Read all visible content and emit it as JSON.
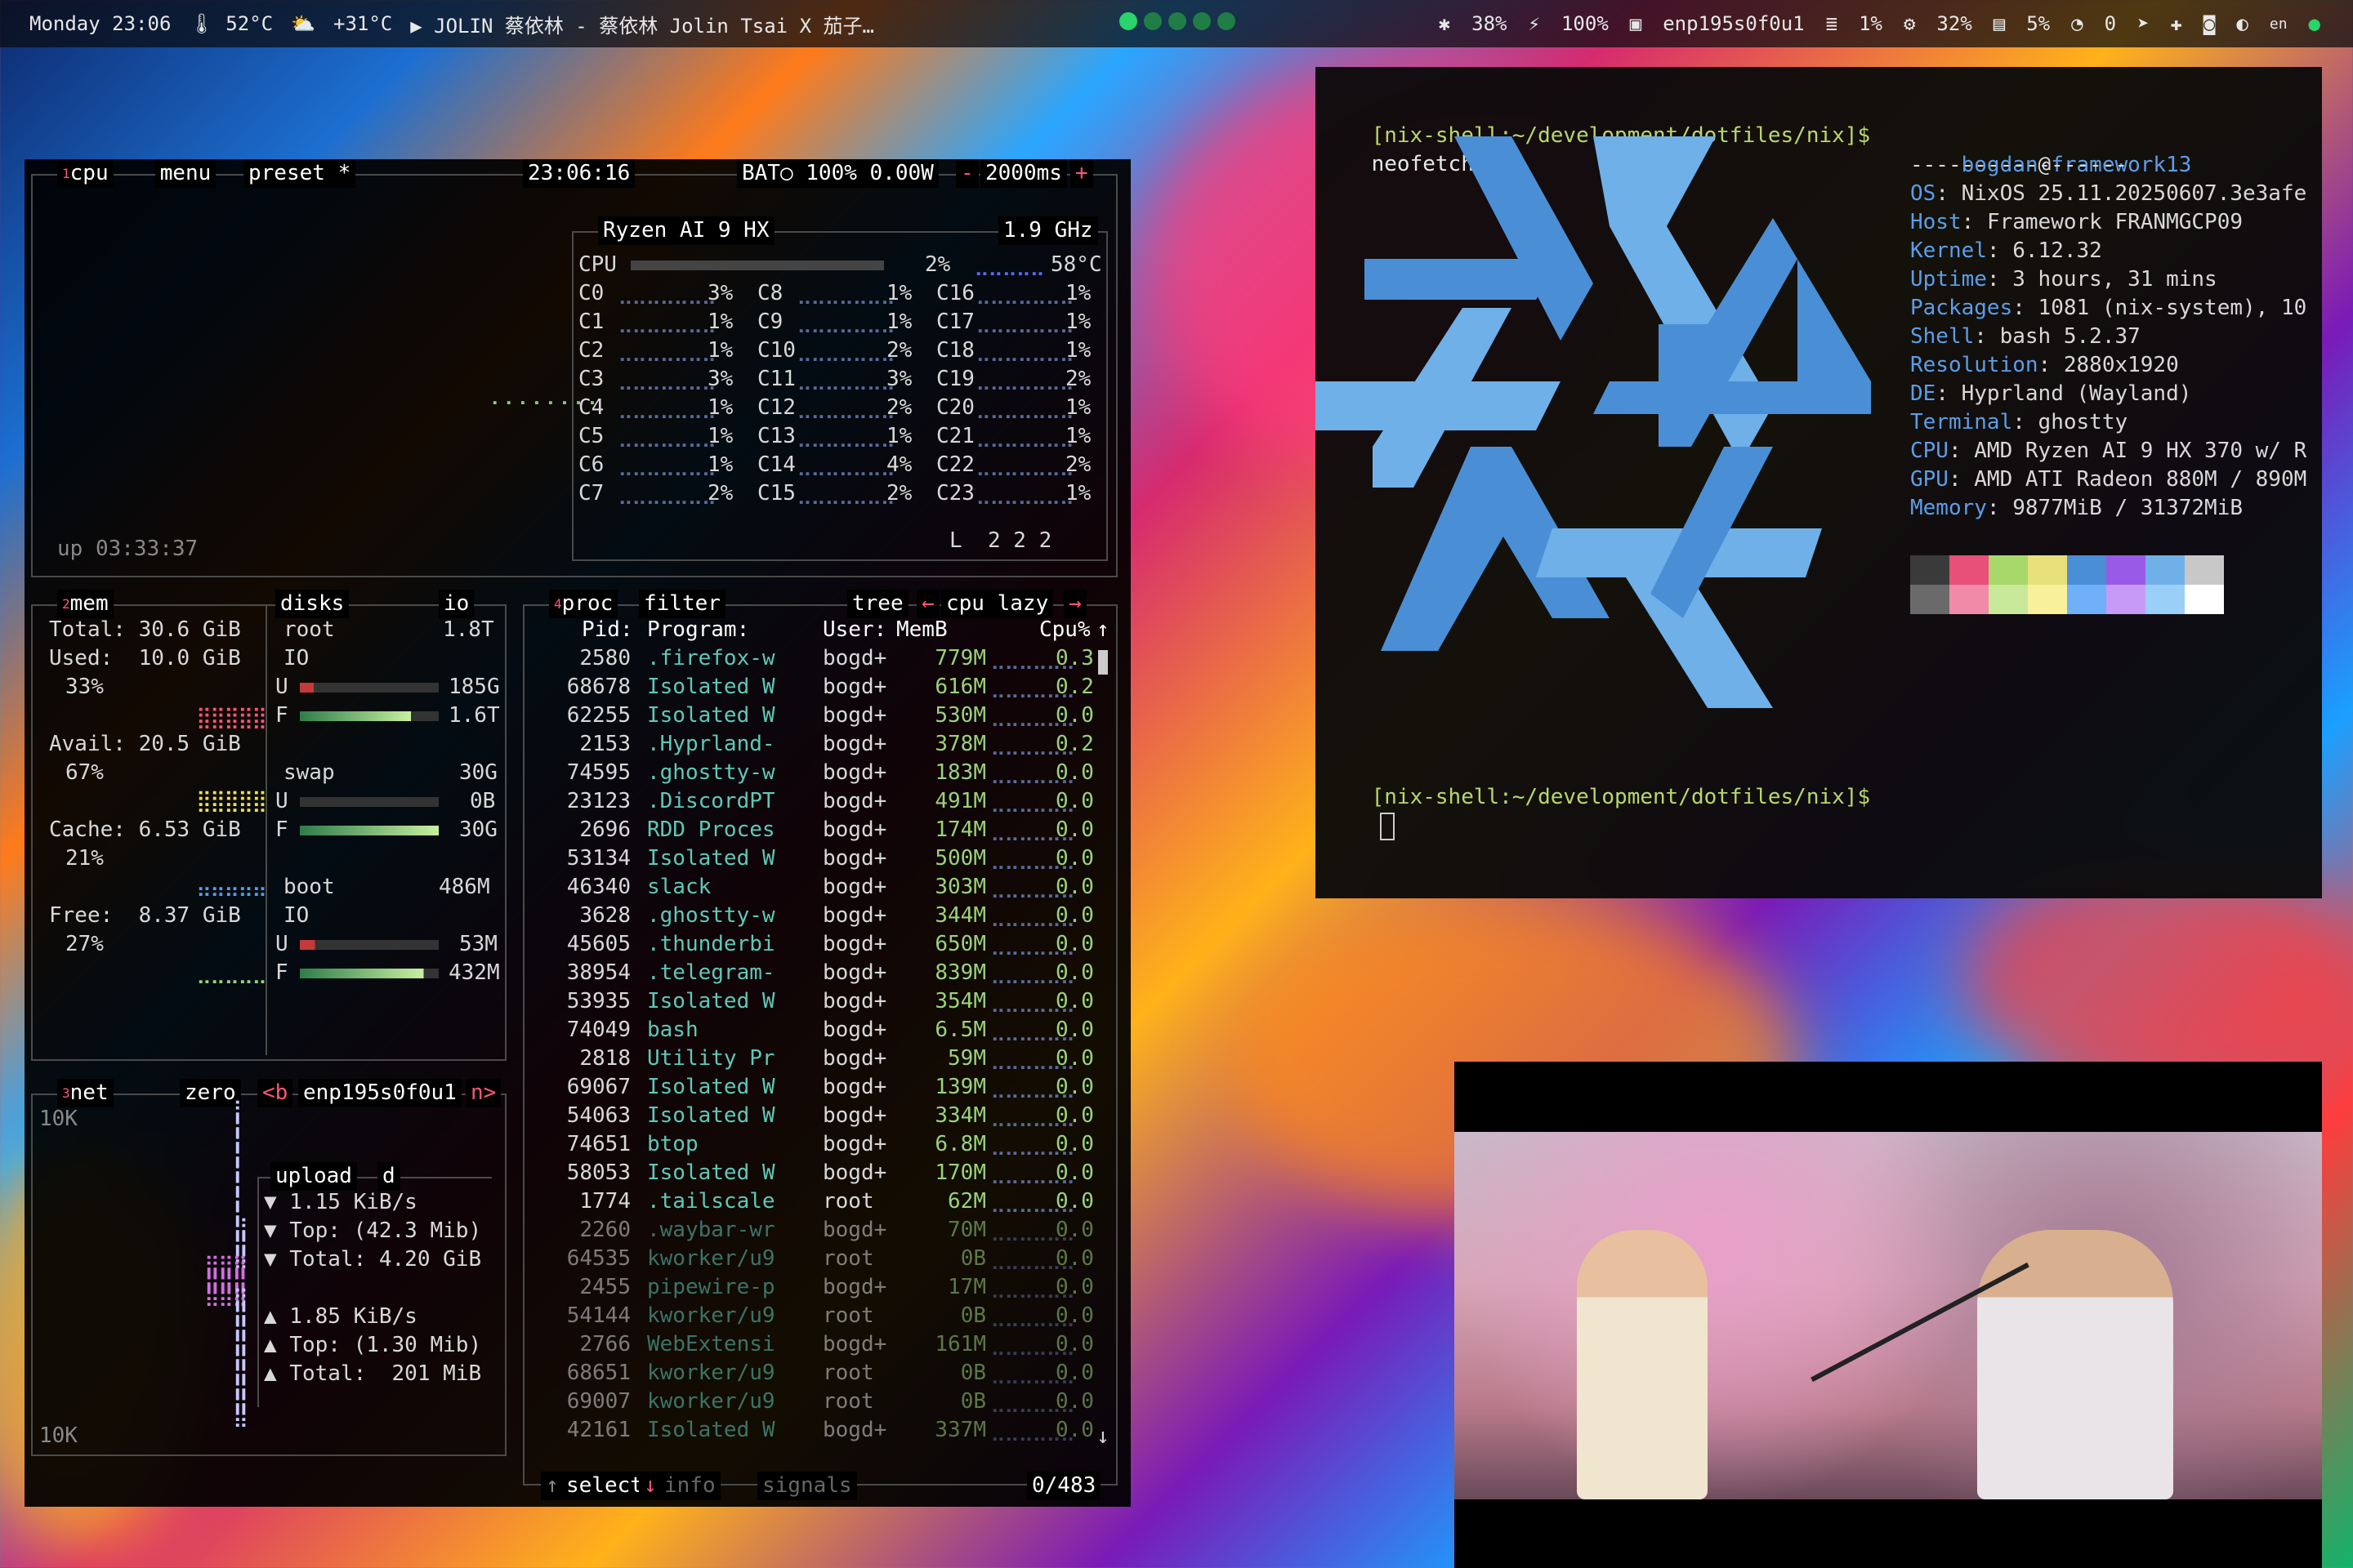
{
  "topbar": {
    "day_time": "Monday 23:06",
    "cpu_temp": "🌡 52°C",
    "weather": "+31°C",
    "media": "▶ JOLIN 蔡依林 - 蔡依林 Jolin Tsai X 茄子…",
    "bluetooth": "38%",
    "battery": "100%",
    "network": "enp195s0f0u1",
    "mem": "1%",
    "cpu": "32%",
    "disk": "5%",
    "notifications": "0",
    "layout": "en"
  },
  "btop": {
    "cpu": {
      "tab": "cpu",
      "menu": "menu",
      "preset": "preset *",
      "clock": "23:06:16",
      "battery": "BAT○ 100% 0.00W",
      "interval": "2000ms",
      "minus": "-",
      "plus": "+",
      "model": "Ryzen AI 9 HX",
      "freq": "1.9 GHz",
      "total_label": "CPU",
      "total_pct": "2%",
      "temp": "58°C",
      "uptime": "up 03:33:37",
      "load": "L  2 2 2",
      "cores": [
        [
          "C0",
          "3%"
        ],
        [
          "C1",
          "1%"
        ],
        [
          "C2",
          "1%"
        ],
        [
          "C3",
          "3%"
        ],
        [
          "C4",
          "1%"
        ],
        [
          "C5",
          "1%"
        ],
        [
          "C6",
          "1%"
        ],
        [
          "C7",
          "2%"
        ],
        [
          "C8",
          "1%"
        ],
        [
          "C9",
          "1%"
        ],
        [
          "C10",
          "2%"
        ],
        [
          "C11",
          "3%"
        ],
        [
          "C12",
          "2%"
        ],
        [
          "C13",
          "1%"
        ],
        [
          "C14",
          "4%"
        ],
        [
          "C15",
          "2%"
        ],
        [
          "C16",
          "1%"
        ],
        [
          "C17",
          "1%"
        ],
        [
          "C18",
          "1%"
        ],
        [
          "C19",
          "2%"
        ],
        [
          "C20",
          "1%"
        ],
        [
          "C21",
          "1%"
        ],
        [
          "C22",
          "2%"
        ],
        [
          "C23",
          "1%"
        ]
      ]
    },
    "mem": {
      "tab": "mem",
      "total": "Total: 30.6 GiB",
      "used": "Used:  10.0 GiB",
      "used_pct": "33%",
      "avail": "Avail: 20.5 GiB",
      "avail_pct": "67%",
      "cache": "Cache: 6.53 GiB",
      "cache_pct": "21%",
      "free": "Free:  8.37 GiB",
      "free_pct": "27%"
    },
    "disks": {
      "tab": "disks",
      "io": "io",
      "root": "root",
      "root_size": "1.8T",
      "io_label": "IO",
      "root_u": "185G",
      "root_f": "1.6T",
      "swap": "swap",
      "swap_size": "30G",
      "swap_u": "0B",
      "swap_f": "30G",
      "boot": "boot",
      "boot_size": "486M",
      "boot_u": "53M",
      "boot_f": "432M",
      "u": "U",
      "f": "F"
    },
    "net": {
      "tab": "net",
      "zero": "zero",
      "b": "<b",
      "iface": "enp195s0f0u1",
      "n": "n>",
      "scale_top": "10K",
      "scale_bottom": "10K",
      "upload": "upload",
      "d": "d",
      "up_rate": "▼ 1.15 KiB/s",
      "up_top": "▼ Top: (42.3 Mib)",
      "up_total": "▼ Total: 4.20 GiB",
      "down_rate": "▲ 1.85 KiB/s",
      "down_top": "▲ Top: (1.30 Mib)",
      "down_total": "▲ Total:  201 MiB"
    },
    "proc": {
      "tab": "proc",
      "filter": "filter",
      "tree": "tree",
      "sort": "cpu lazy",
      "headers": [
        "Pid:",
        "Program:",
        "User:",
        "MemB",
        "Cpu%"
      ],
      "rows": [
        [
          "2580",
          ".firefox-w",
          "bogd+",
          "779M",
          "0.3"
        ],
        [
          "68678",
          "Isolated W",
          "bogd+",
          "616M",
          "0.2"
        ],
        [
          "62255",
          "Isolated W",
          "bogd+",
          "530M",
          "0.0"
        ],
        [
          "2153",
          ".Hyprland-",
          "bogd+",
          "378M",
          "0.2"
        ],
        [
          "74595",
          ".ghostty-w",
          "bogd+",
          "183M",
          "0.0"
        ],
        [
          "23123",
          ".DiscordPT",
          "bogd+",
          "491M",
          "0.0"
        ],
        [
          "2696",
          "RDD Proces",
          "bogd+",
          "174M",
          "0.0"
        ],
        [
          "53134",
          "Isolated W",
          "bogd+",
          "500M",
          "0.0"
        ],
        [
          "46340",
          "slack",
          "bogd+",
          "303M",
          "0.0"
        ],
        [
          "3628",
          ".ghostty-w",
          "bogd+",
          "344M",
          "0.0"
        ],
        [
          "45605",
          ".thunderbi",
          "bogd+",
          "650M",
          "0.0"
        ],
        [
          "38954",
          ".telegram-",
          "bogd+",
          "839M",
          "0.0"
        ],
        [
          "53935",
          "Isolated W",
          "bogd+",
          "354M",
          "0.0"
        ],
        [
          "74049",
          "bash",
          "bogd+",
          "6.5M",
          "0.0"
        ],
        [
          "2818",
          "Utility Pr",
          "bogd+",
          "59M",
          "0.0"
        ],
        [
          "69067",
          "Isolated W",
          "bogd+",
          "139M",
          "0.0"
        ],
        [
          "54063",
          "Isolated W",
          "bogd+",
          "334M",
          "0.0"
        ],
        [
          "74651",
          "btop",
          "bogd+",
          "6.8M",
          "0.0"
        ],
        [
          "58053",
          "Isolated W",
          "bogd+",
          "170M",
          "0.0"
        ],
        [
          "1774",
          ".tailscale",
          "root",
          "62M",
          "0.0"
        ],
        [
          "2260",
          ".waybar-wr",
          "bogd+",
          "70M",
          "0.0"
        ],
        [
          "64535",
          "kworker/u9",
          "root",
          "0B",
          "0.0"
        ],
        [
          "2455",
          "pipewire-p",
          "bogd+",
          "17M",
          "0.0"
        ],
        [
          "54144",
          "kworker/u9",
          "root",
          "0B",
          "0.0"
        ],
        [
          "2766",
          "WebExtensi",
          "bogd+",
          "161M",
          "0.0"
        ],
        [
          "68651",
          "kworker/u9",
          "root",
          "0B",
          "0.0"
        ],
        [
          "69007",
          "kworker/u9",
          "root",
          "0B",
          "0.0"
        ],
        [
          "42161",
          "Isolated W",
          "bogd+",
          "337M",
          "0.0"
        ]
      ],
      "footer_select": "select",
      "footer_info": "info",
      "footer_signals": "signals",
      "count": "0/483"
    }
  },
  "terminal": {
    "prompt": "[nix-shell:~/development/dotfiles/nix]$",
    "command": "neofetch",
    "user": "bogdan",
    "at": "@",
    "host": "framework13",
    "separator": "-----------------",
    "info": [
      [
        "OS",
        "NixOS 25.11.20250607.3e3afe"
      ],
      [
        "Host",
        "Framework FRANMGCP09"
      ],
      [
        "Kernel",
        "6.12.32"
      ],
      [
        "Uptime",
        "3 hours, 31 mins"
      ],
      [
        "Packages",
        "1081 (nix-system), 10"
      ],
      [
        "Shell",
        "bash 5.2.37"
      ],
      [
        "Resolution",
        "2880x1920"
      ],
      [
        "DE",
        "Hyprland (Wayland)"
      ],
      [
        "Terminal",
        "ghostty"
      ],
      [
        "CPU",
        "AMD Ryzen AI 9 HX 370 w/ R"
      ],
      [
        "GPU",
        "AMD ATI Radeon 880M / 890M"
      ],
      [
        "Memory",
        "9877MiB / 31372MiB"
      ]
    ],
    "palette": [
      "#3a3a3a",
      "#e8507a",
      "#a8d86a",
      "#e8e07a",
      "#4a8fd6",
      "#9a5ae8",
      "#6fb0e8",
      "#c8c8c8"
    ],
    "palette_bright": [
      "#6a6a6a",
      "#f08aa8",
      "#c8e89a",
      "#f8f09a",
      "#6fb0f8",
      "#c89af8",
      "#9ad0f8",
      "#ffffff"
    ]
  },
  "colors": {
    "accent_green": "#9ad27a",
    "accent_red": "#ff5577",
    "logo_dark": "#4a8fd6",
    "logo_light": "#6fb0e8"
  }
}
